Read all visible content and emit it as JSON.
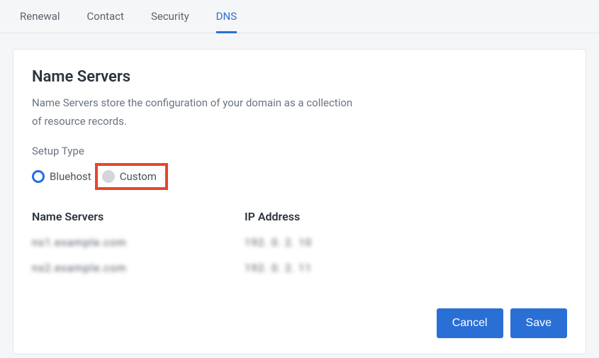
{
  "tabs": {
    "renewal": "Renewal",
    "contact": "Contact",
    "security": "Security",
    "dns": "DNS"
  },
  "card": {
    "title": "Name Servers",
    "description": "Name Servers store the configuration of your domain as a collection of resource records.",
    "setup_type_label": "Setup Type",
    "radio_bluehost": "Bluehost",
    "radio_custom": "Custom",
    "col_ns": "Name Servers",
    "col_ip": "IP Address",
    "ns_values": [
      "ns1.example.com",
      "ns2.example.com"
    ],
    "ip_values": [
      "192. 0. 2. 10",
      "192. 0. 2. 11"
    ],
    "cancel": "Cancel",
    "save": "Save"
  }
}
